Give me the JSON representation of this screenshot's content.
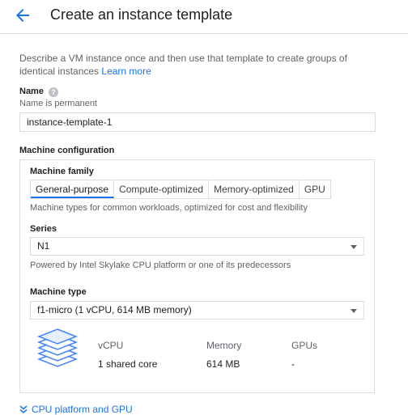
{
  "header": {
    "title": "Create an instance template"
  },
  "description": {
    "text": "Describe a VM instance once and then use that template to create groups of identical instances",
    "link": "Learn more"
  },
  "name_section": {
    "label": "Name",
    "hint": "Name is permanent",
    "value": "instance-template-1"
  },
  "machine_config": {
    "title": "Machine configuration",
    "family": {
      "label": "Machine family",
      "tabs": [
        "General-purpose",
        "Compute-optimized",
        "Memory-optimized",
        "GPU"
      ],
      "selected": "General-purpose",
      "hint": "Machine types for common workloads, optimized for cost and flexibility"
    },
    "series": {
      "label": "Series",
      "value": "N1",
      "hint": "Powered by Intel Skylake CPU platform or one of its predecessors"
    },
    "machine_type": {
      "label": "Machine type",
      "value": "f1-micro (1 vCPU, 614 MB memory)"
    },
    "specs": {
      "vcpu_label": "vCPU",
      "vcpu_value": "1 shared core",
      "memory_label": "Memory",
      "memory_value": "614 MB",
      "gpus_label": "GPUs",
      "gpus_value": "-"
    }
  },
  "expander": {
    "label": "CPU platform and GPU"
  },
  "colors": {
    "accent": "#1a73e8",
    "border": "#dadce0",
    "text": "#202124",
    "muted": "#5f6368"
  }
}
